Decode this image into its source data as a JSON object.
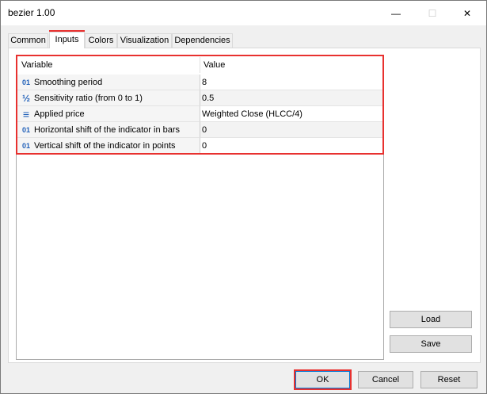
{
  "window": {
    "title": "bezier 1.00"
  },
  "titlebar": {
    "minimize_glyph": "—",
    "maximize_glyph": "☐",
    "close_glyph": "✕"
  },
  "tabs": [
    {
      "label": "Common",
      "active": false
    },
    {
      "label": "Inputs",
      "active": true
    },
    {
      "label": "Colors",
      "active": false
    },
    {
      "label": "Visualization",
      "active": false
    },
    {
      "label": "Dependencies",
      "active": false
    }
  ],
  "grid": {
    "headers": {
      "variable": "Variable",
      "value": "Value"
    },
    "rows": [
      {
        "icon": "int-icon",
        "icon_glyph": "01",
        "variable": "Smoothing period",
        "value": "8"
      },
      {
        "icon": "fraction-icon",
        "icon_glyph": "½",
        "variable": "Sensitivity ratio (from 0 to 1)",
        "value": "0.5"
      },
      {
        "icon": "enum-list-icon",
        "icon_glyph": "≡",
        "variable": "Applied price",
        "value": "Weighted Close (HLCC/4)"
      },
      {
        "icon": "int-icon",
        "icon_glyph": "01",
        "variable": "Horizontal shift of the indicator in bars",
        "value": "0"
      },
      {
        "icon": "int-icon",
        "icon_glyph": "01",
        "variable": "Vertical shift of the indicator in points",
        "value": "0"
      }
    ]
  },
  "side_buttons": {
    "load": "Load",
    "save": "Save"
  },
  "footer": {
    "ok": "OK",
    "cancel": "Cancel",
    "reset": "Reset"
  },
  "colors": {
    "highlight": "#e8312f",
    "icon_blue": "#1f5fb8"
  }
}
